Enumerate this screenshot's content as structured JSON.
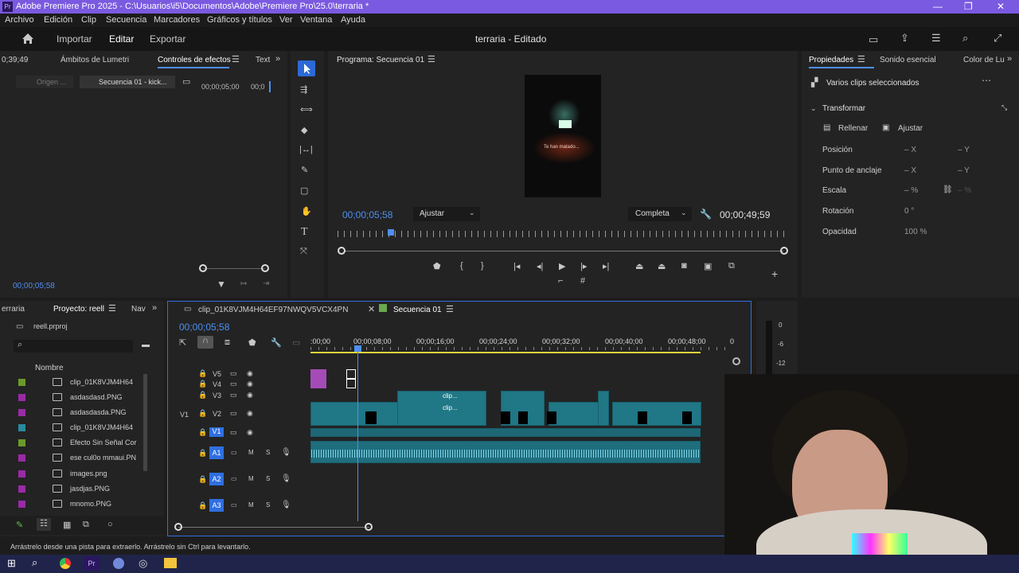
{
  "window": {
    "title": "Adobe Premiere Pro 2025 - C:\\Usuarios\\i5\\Documentos\\Adobe\\Premiere Pro\\25.0\\terraria *"
  },
  "menu": [
    "Archivo",
    "Edición",
    "Clip",
    "Secuencia",
    "Marcadores",
    "Gráficos y títulos",
    "Ver",
    "Ventana",
    "Ayuda"
  ],
  "workspace": {
    "import": "Importar",
    "edit": "Editar",
    "export": "Exportar",
    "project_title": "terraria - Editado"
  },
  "source_panel": {
    "tabs": [
      "0;39;49",
      "Ámbitos de Lumetri",
      "Controles de efectos",
      "Text"
    ],
    "subtab_origen": "Origen ...",
    "subtab_seq": "Secuencia 01 - kick...",
    "tc_a": "00;00;05;00",
    "tc_b": "00;0",
    "timecode": "00;00;05;58"
  },
  "program": {
    "title": "Programa: Secuencia 01",
    "timecode": "00;00;05;58",
    "fit": "Ajustar",
    "quality": "Completa",
    "duration": "00;00;49;59",
    "overlay_text": "Te han matado..."
  },
  "properties": {
    "tabs": [
      "Propiedades",
      "Sonido esencial",
      "Color de Lu"
    ],
    "selection": "Varios clips seleccionados",
    "section": "Transformar",
    "fill": "Rellenar",
    "fit": "Ajustar",
    "rows": [
      {
        "label": "Posición",
        "v1": "– X",
        "v2": "– Y"
      },
      {
        "label": "Punto de anclaje",
        "v1": "– X",
        "v2": "– Y"
      },
      {
        "label": "Escala",
        "v1": "– %",
        "v2": "– %"
      },
      {
        "label": "Rotación",
        "v1": "0 °",
        "v2": ""
      },
      {
        "label": "Opacidad",
        "v1": "100 %",
        "v2": ""
      }
    ]
  },
  "project": {
    "tabs": [
      "erraria",
      "Proyecto: reell",
      "Nav"
    ],
    "file": "reell.prproj",
    "column": "Nombre",
    "items": [
      {
        "name": "clip_01K8VJM4H64",
        "color": "#6a9a2a"
      },
      {
        "name": "asdasdasd.PNG",
        "color": "#9a2aa6"
      },
      {
        "name": "asdasdasda.PNG",
        "color": "#9a2aa6"
      },
      {
        "name": "clip_01K8VJM4H64",
        "color": "#2a8aa0"
      },
      {
        "name": "Efecto Sin Señal Cor",
        "color": "#6a9a2a"
      },
      {
        "name": "ese cul0o mmaui.PN",
        "color": "#9a2aa6"
      },
      {
        "name": "images.png",
        "color": "#9a2aa6"
      },
      {
        "name": "jasdjas.PNG",
        "color": "#9a2aa6"
      },
      {
        "name": "mnomo.PNG",
        "color": "#9a2aa6"
      }
    ]
  },
  "timeline": {
    "tabs": [
      "clip_01K8VJM4H64EF97NWQV5VCX4PN",
      "Secuencia 01"
    ],
    "timecode": "00;00;05;58",
    "ruler": [
      ":00;00",
      "00;00;08;00",
      "00;00;16;00",
      "00;00;24;00",
      "00;00;32;00",
      "00;00;40;00",
      "00;00;48;00",
      "0"
    ],
    "video_tracks": [
      "V5",
      "V4",
      "V3",
      "V2",
      "V1"
    ],
    "v1_source": "V1",
    "audio_tracks": [
      "A1",
      "A2",
      "A3"
    ],
    "clip_label": "clip..."
  },
  "meter": [
    "0",
    "-6",
    "-12"
  ],
  "status": "Arrástrelo desde una pista para extraerlo. Arrástrelo sin Ctrl para levantarlo.",
  "colors": {
    "accent": "#4e8ff0",
    "titlebar": "#7a5ae0",
    "clip_video": "#207786",
    "clip_image": "#a54bb8",
    "track_target": "#2f6fe0"
  }
}
